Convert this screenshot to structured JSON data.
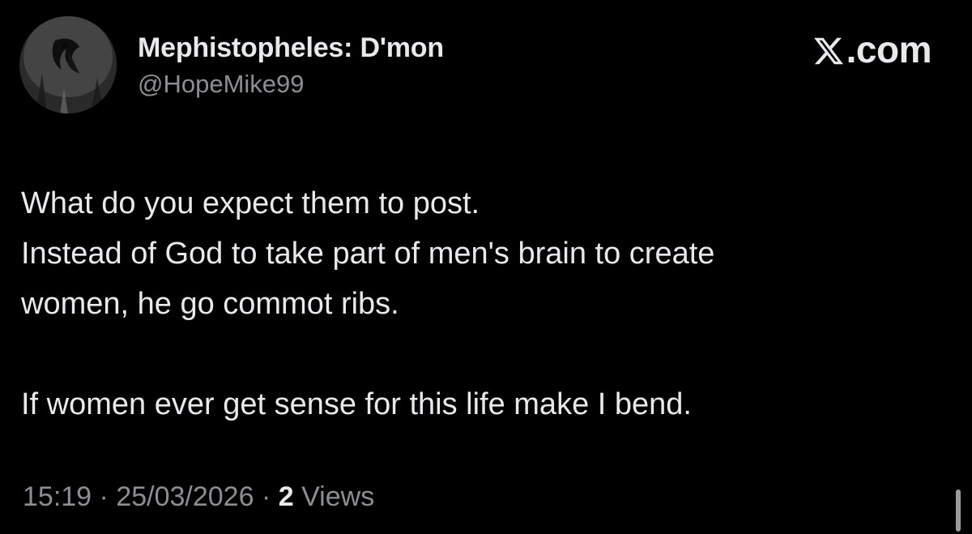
{
  "author": {
    "display_name": "Mephistopheles: D'mon",
    "handle": "@HopeMike99",
    "avatar_icon": "dark-angel-avatar"
  },
  "brand": {
    "text": ".com",
    "logo_icon": "x-logo-icon"
  },
  "post": {
    "lines": [
      "What do you expect them to post.",
      "Instead of God to take part of men's brain to create",
      "women, he go commot ribs."
    ],
    "closing": "If women ever get sense for this life make I bend."
  },
  "meta": {
    "time": "15:19",
    "separator": "·",
    "date": "25/03/2026",
    "views_count": "2",
    "views_label": "Views"
  },
  "colors": {
    "background": "#000000",
    "text": "#e7e9ea",
    "muted": "#8b8f94"
  }
}
